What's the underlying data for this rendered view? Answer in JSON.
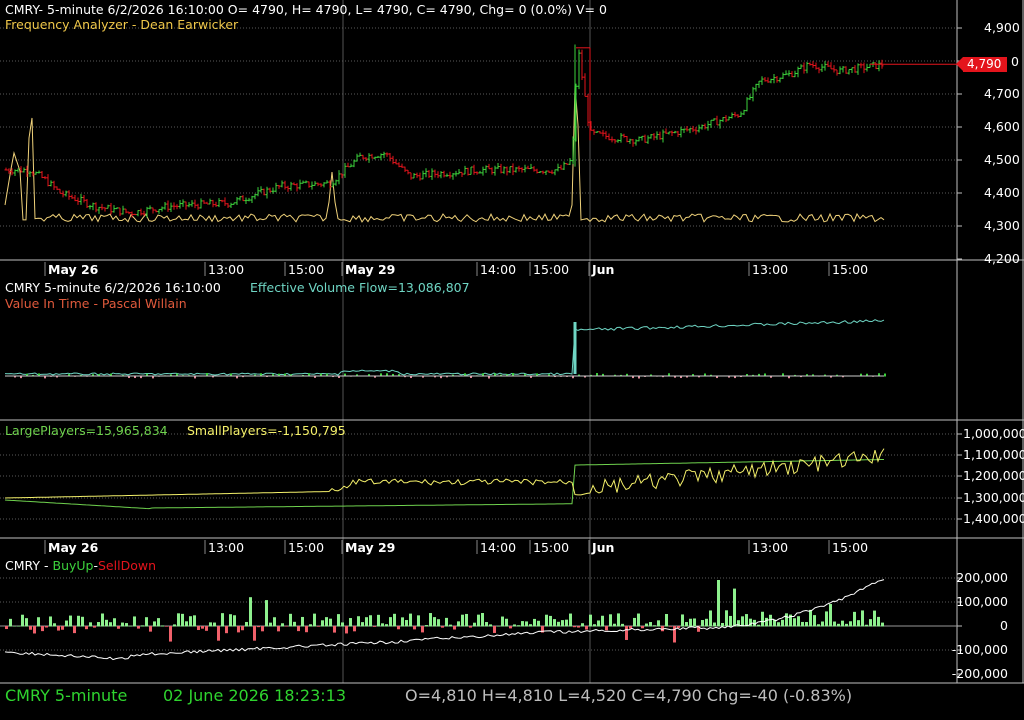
{
  "panel1": {
    "header": "CMRY- 5-minute 6/2/2026 16:10:00 O= 4790, H= 4790, L= 4790, C= 4790, Chg= 0 (0.0%) V= 0",
    "indicator": "Frequency Analyzer - Dean Earwicker",
    "price_tag": "4,790",
    "price_tag_partial": "0"
  },
  "panel2": {
    "header_symbol": "CMRY 5-minute  6/2/2026 16:10:00",
    "header_indicator": "Effective Volume Flow=13,086,807",
    "indicator2": "Value In Time - Pascal Willain"
  },
  "panel3": {
    "large": "LargePlayers=15,965,834",
    "small": "SmallPlayers=-1,150,795"
  },
  "panel4": {
    "header_symbol": "CMRY - ",
    "buy": "BuyUp",
    "dash": "-",
    "sell": "SellDown"
  },
  "status": {
    "symbol": "CMRY  5-minute",
    "datetime": "02 June 2026 18:23:13",
    "ohlc": "O=4,810  H=4,810  L=4,520  C=4,790  Chg=-40 (-0.83%)"
  },
  "axes": {
    "price_ticks": [
      "4,900",
      "4,800",
      "4,700",
      "4,600",
      "4,500",
      "4,400",
      "4,300",
      "4,200"
    ],
    "player_ticks": [
      "1,000,000",
      "1,100,000",
      "1,200,000",
      "1,300,000",
      "1,400,000"
    ],
    "buysell_ticks": [
      "200,000",
      "100,000",
      "0",
      "-100,000",
      "-200,000"
    ],
    "time_labels": [
      "May 26",
      "13:00",
      "15:00",
      "May 29",
      "14:00",
      "15:00",
      "Jun",
      "13:00",
      "15:00"
    ]
  },
  "colors": {
    "up": "#3cd23c",
    "down": "#e4141c",
    "freq": "#f0d27a",
    "flow": "#6fd6c4",
    "value_in_time": "#e05a3c",
    "large": "#6fd24e",
    "small": "#f4f06a",
    "buysell_line": "#ffffff",
    "status_green": "#2fd42f",
    "status_gray": "#bdbdbd"
  }
}
